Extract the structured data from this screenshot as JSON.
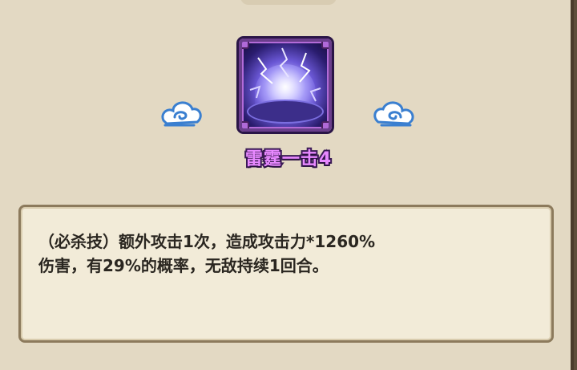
{
  "skill": {
    "name": "雷霆一击4",
    "icon": "thunder-dome-skill-icon"
  },
  "decor": {
    "left_icon": "cloud-swirl-icon",
    "right_icon": "cloud-swirl-icon"
  },
  "description": {
    "line1": "（必杀技）额外攻击1次，造成攻击力*1260%",
    "line2": "伤害，有29%的概率，无敌持续1回合。"
  },
  "colors": {
    "skill_name": "#e889ff",
    "panel": "#e3d9c3",
    "desc_box": "#f2ebd8"
  }
}
